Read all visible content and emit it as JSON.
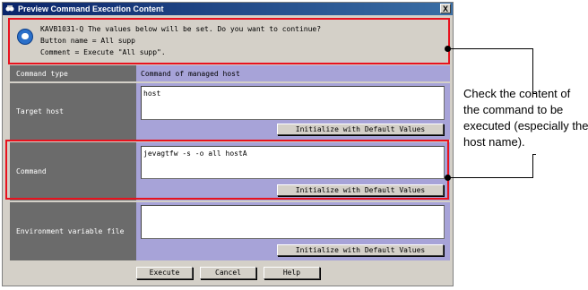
{
  "window": {
    "title": "Preview Command Execution Content",
    "close_glyph": "X"
  },
  "message": {
    "lines": [
      "KAVB1031-Q The values below will be set. Do you want to continue?",
      "Button name = All supp",
      "Comment = Execute \"All supp\"."
    ]
  },
  "rows": {
    "command_type": {
      "label": "Command type",
      "value": "Command of managed host"
    },
    "target_host": {
      "label": "Target host",
      "value": "host",
      "button": "Initialize with Default Values"
    },
    "command": {
      "label": "Command",
      "value": "jevagtfw -s -o all hostA",
      "button": "Initialize with Default Values"
    },
    "env_file": {
      "label": "Environment variable file",
      "value": "",
      "button": "Initialize with Default Values"
    }
  },
  "footer": {
    "execute": "Execute",
    "cancel": "Cancel",
    "help": "Help"
  },
  "callout": {
    "text": "Check the content of the command to be executed (especially the host name)."
  },
  "colors": {
    "highlight": "#e8121e",
    "label_bg": "#6b6b6b",
    "value_bg": "#a7a3d8",
    "dialog_bg": "#d4d0c8"
  }
}
